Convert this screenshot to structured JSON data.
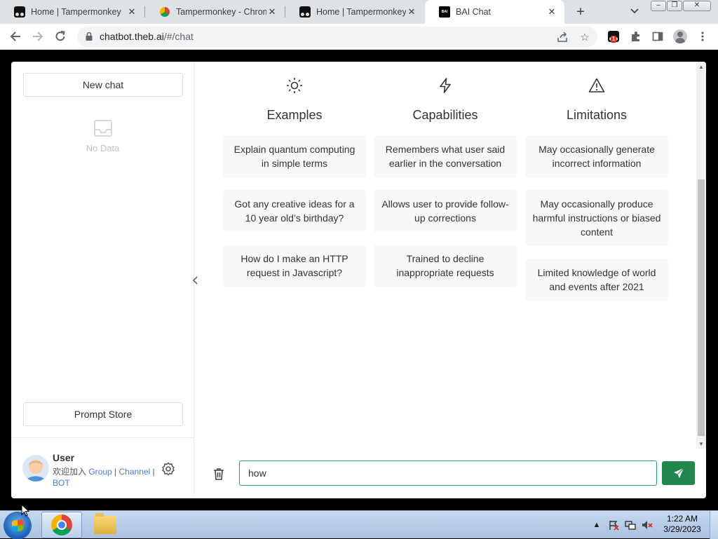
{
  "browser": {
    "tabs": [
      {
        "title": "Home | Tampermonkey",
        "icon": "tampermonkey-icon",
        "active": false
      },
      {
        "title": "Tampermonkey - Chrome",
        "icon": "chrome-webstore-icon",
        "active": false
      },
      {
        "title": "Home | Tampermonkey",
        "icon": "tampermonkey-icon",
        "active": false
      },
      {
        "title": "BAI Chat",
        "icon": "bai-icon",
        "active": true
      }
    ],
    "new_tab": "+",
    "url_host": "chatbot.theb.ai",
    "url_path": "/#/chat",
    "extension_badge": "1",
    "favicon_label": "BAI"
  },
  "sidebar": {
    "new_chat_label": "New chat",
    "no_data_label": "No Data",
    "prompt_store_label": "Prompt Store",
    "user": {
      "name": "User",
      "join_prefix": "欢迎加入 ",
      "group_link": "Group",
      "sep1": " | ",
      "channel_link": "Channel",
      "sep2": " | ",
      "bot_link": "BOT"
    }
  },
  "main": {
    "columns": [
      {
        "icon": "sun-icon",
        "title": "Examples",
        "cards": [
          "Explain quantum computing in simple terms",
          "Got any creative ideas for a 10 year old’s birthday?",
          "How do I make an HTTP request in Javascript?"
        ]
      },
      {
        "icon": "lightning-icon",
        "title": "Capabilities",
        "cards": [
          "Remembers what user said earlier in the conversation",
          "Allows user to provide follow-up corrections",
          "Trained to decline inappropriate requests"
        ]
      },
      {
        "icon": "warning-icon",
        "title": "Limitations",
        "cards": [
          "May occasionally generate incorrect information",
          "May occasionally produce harmful instructions or biased content",
          "Limited knowledge of world and events after 2021"
        ]
      }
    ],
    "input_value": "how"
  },
  "taskbar": {
    "time": "1:22 AM",
    "date": "3/29/2023"
  },
  "colors": {
    "accent_green": "#22874f",
    "input_border": "#2e9c6a"
  }
}
